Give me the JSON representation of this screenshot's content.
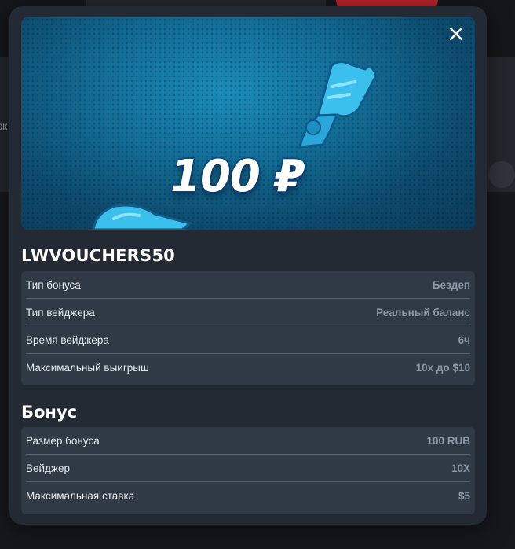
{
  "banner": {
    "amount": "100 ₽"
  },
  "close": {
    "icon": "close-icon"
  },
  "code": {
    "title": "LWVOUCHERS50",
    "rows": [
      {
        "label": "Тип бонуса",
        "value": "Бездеп"
      },
      {
        "label": "Тип вейджера",
        "value": "Реальный баланс"
      },
      {
        "label": "Время вейджера",
        "value": "6ч"
      },
      {
        "label": "Максимальный выигрыш",
        "value": "10х до $10"
      }
    ]
  },
  "bonus": {
    "title": "Бонус",
    "rows": [
      {
        "label": "Размер бонуса",
        "value": "100 RUB"
      },
      {
        "label": "Вейджер",
        "value": "10X"
      },
      {
        "label": "Максимальная ставка",
        "value": "$5"
      }
    ]
  },
  "background": {
    "partial_char": "ж"
  },
  "colors": {
    "modal_bg": "#232a33",
    "table_bg": "#2f3a44",
    "banner_accent": "#1a8bb8"
  }
}
